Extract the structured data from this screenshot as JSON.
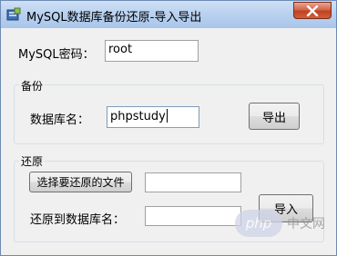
{
  "window": {
    "title": "MySQL数据库备份还原-导入导出",
    "close_label": "关闭"
  },
  "password": {
    "label": "MySQL密码：",
    "value": "root"
  },
  "backup": {
    "group_title": "备份",
    "db_label": "数据库名：",
    "db_value": "phpstudy",
    "export_button": "导出"
  },
  "restore": {
    "group_title": "还原",
    "choose_file_button": "选择要还原的文件",
    "file_value": "",
    "target_label": "还原到数据库名：",
    "target_value": "",
    "import_button": "导入"
  },
  "watermark": {
    "logo_text": "php",
    "text": "中文网"
  }
}
